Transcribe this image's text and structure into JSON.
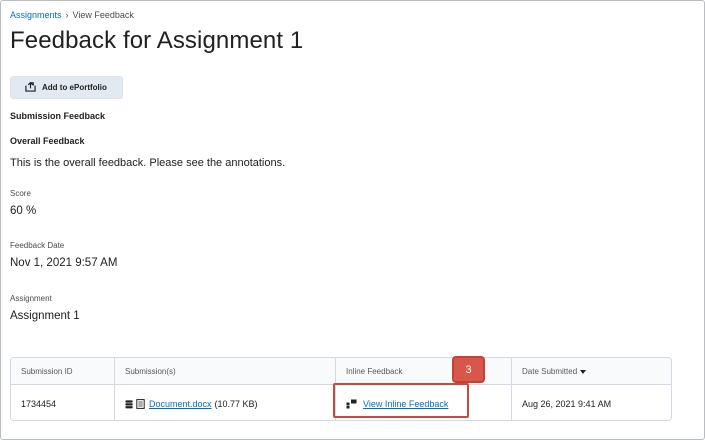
{
  "breadcrumb": {
    "parent": "Assignments",
    "separator": "›",
    "current": "View Feedback"
  },
  "page_title": "Feedback for Assignment 1",
  "toolbar": {
    "add_to_eportfolio_label": "Add to ePortfolio"
  },
  "submission_feedback_heading": "Submission Feedback",
  "overall_feedback": {
    "label": "Overall Feedback",
    "text": "This is the overall feedback. Please see the annotations."
  },
  "score": {
    "label": "Score",
    "value": "60 %"
  },
  "feedback_date": {
    "label": "Feedback Date",
    "value": "Nov 1, 2021 9:57 AM"
  },
  "assignment": {
    "label": "Assignment",
    "value": "Assignment 1"
  },
  "table": {
    "headers": [
      "Submission ID",
      "Submission(s)",
      "Inline Feedback",
      "Date Submitted"
    ],
    "rows": [
      {
        "submission_id": "1734454",
        "file_name": "Document.docx",
        "file_size": "(10.77 KB)",
        "inline_feedback": "View Inline Feedback",
        "date_submitted": "Aug 26, 2021 9:41 AM"
      }
    ]
  },
  "annotation": {
    "callout_number": "3",
    "color": "#d9574a"
  },
  "colors": {
    "link": "#006fbf",
    "button_bg": "#e3e9f1",
    "highlight": "#c8493f"
  }
}
